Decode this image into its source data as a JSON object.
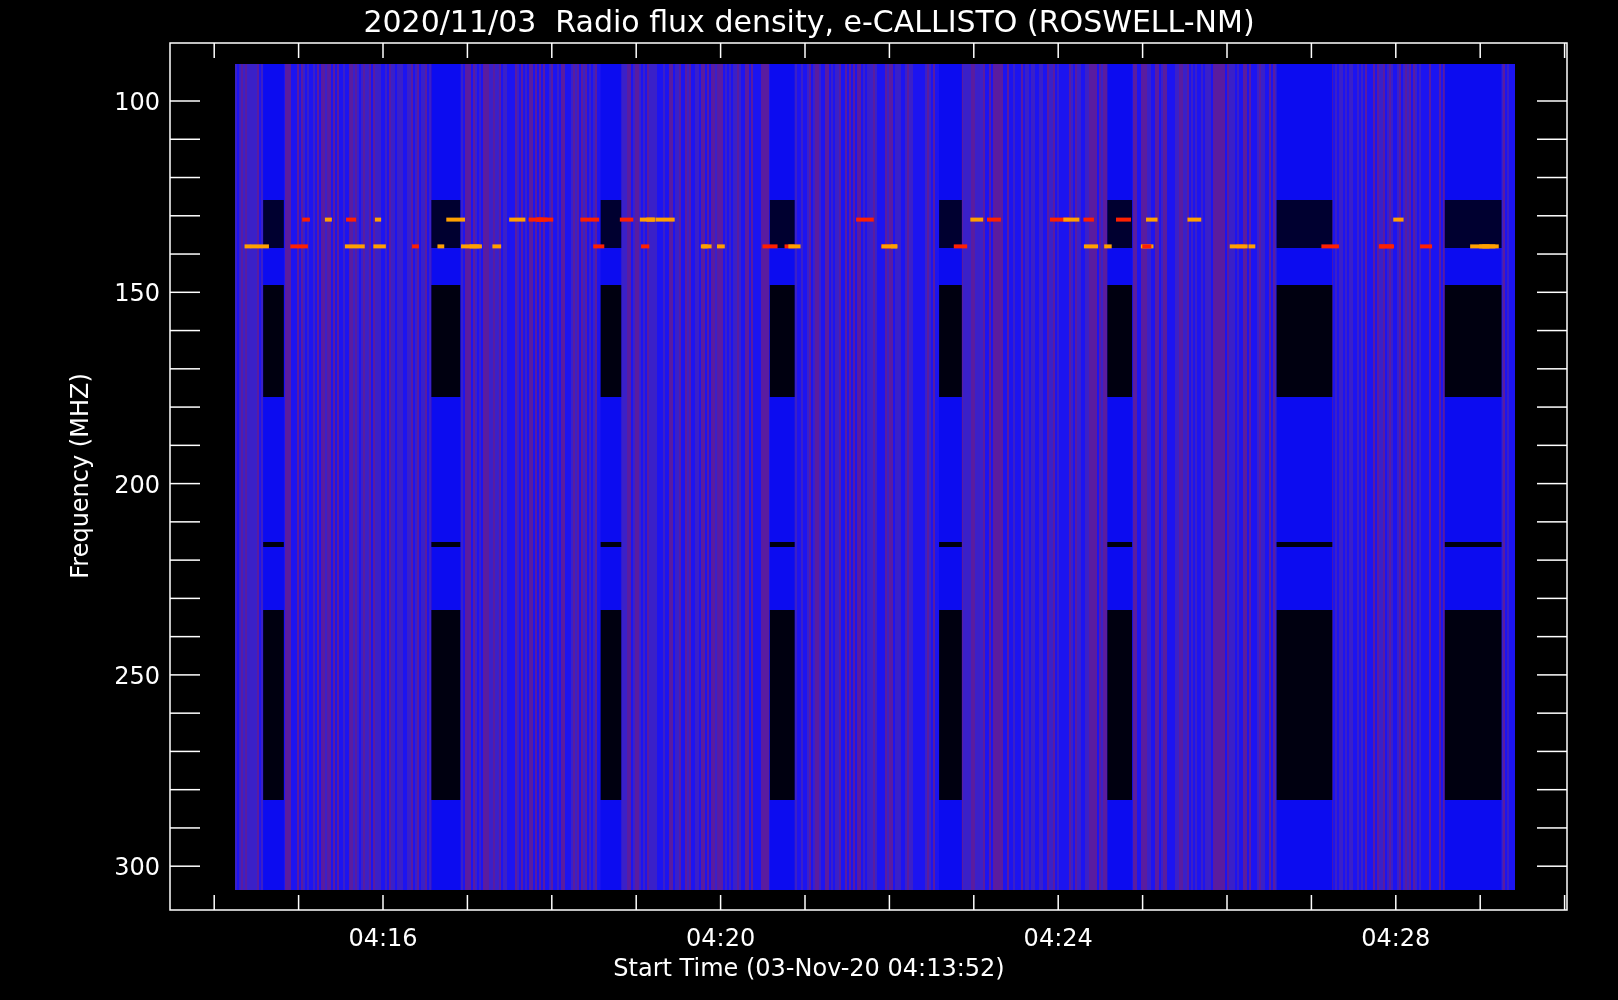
{
  "title": "2020/11/03  Radio flux density, e-CALLISTO (ROSWELL-NM)",
  "y_axis": {
    "label": "Frequency (MHZ)",
    "ticks": [
      "100",
      "150",
      "200",
      "250",
      "300"
    ]
  },
  "x_axis": {
    "label": "Start Time (03-Nov-20 04:13:52)",
    "ticks": [
      "04:16",
      "04:20",
      "04:24",
      "04:28"
    ]
  }
}
